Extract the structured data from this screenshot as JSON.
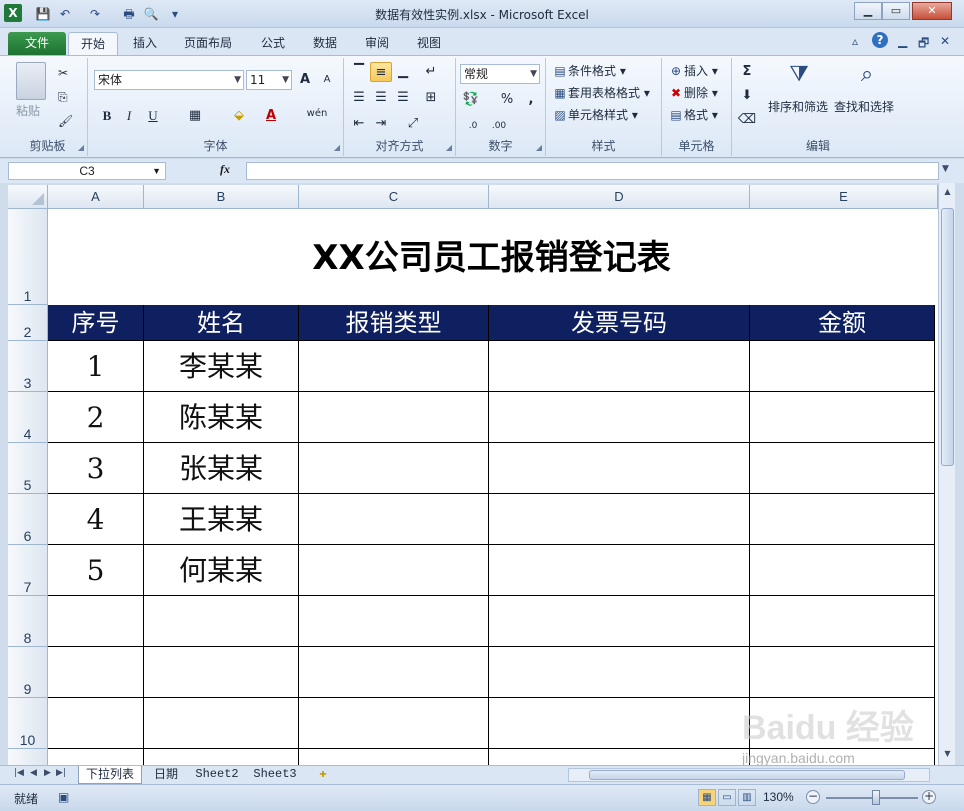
{
  "window": {
    "title": "数据有效性实例.xlsx - Microsoft Excel",
    "app_icon": "X",
    "minimize": "▁",
    "restore": "▭",
    "close": "✕"
  },
  "qat": {
    "save": "💾",
    "undo": "↶",
    "redo": "↷",
    "print": "🖶",
    "preview": "🔍",
    "more": "▾"
  },
  "ribbon_tabs": [
    "文件",
    "开始",
    "插入",
    "页面布局",
    "公式",
    "数据",
    "审阅",
    "视图"
  ],
  "tab_right": {
    "expand": "▵",
    "help": "?",
    "minimize": "▁",
    "restore": "🗗",
    "close": "✕"
  },
  "ribbon": {
    "clipboard": {
      "label": "剪贴板",
      "paste": "粘贴",
      "cut": "✂",
      "copy": "⎘",
      "format_painter": "🖌"
    },
    "font": {
      "label": "字体",
      "font_name": "宋体",
      "font_size": "11",
      "grow": "A",
      "shrink": "A",
      "bold": "B",
      "italic": "I",
      "underline": "U",
      "border": "▦",
      "fill": "⬙",
      "font_color": "A",
      "phonetic": "wén"
    },
    "alignment": {
      "label": "对齐方式"
    },
    "number": {
      "label": "数字",
      "format": "常规",
      "currency": "💱",
      "percent": "%",
      "comma": ",",
      "inc_decimal": ".0",
      "dec_decimal": ".00"
    },
    "styles": {
      "label": "样式",
      "conditional": "条件格式",
      "table": "套用表格格式",
      "cell_styles": "单元格样式"
    },
    "cells": {
      "label": "单元格",
      "insert": "插入",
      "delete": "删除",
      "format": "格式"
    },
    "editing": {
      "label": "编辑",
      "sigma": "Σ",
      "fill": "⬇",
      "clear": "⌫",
      "sort": "排序和筛选",
      "find": "查找和选择"
    }
  },
  "formula_bar": {
    "name_box": "C3",
    "fx": "fx",
    "value": ""
  },
  "columns": [
    "A",
    "B",
    "C",
    "D",
    "E"
  ],
  "rows": [
    "1",
    "2",
    "3",
    "4",
    "5",
    "6",
    "7",
    "8",
    "9",
    "10"
  ],
  "sheet": {
    "title": "XX公司员工报销登记表",
    "headers": [
      "序号",
      "姓名",
      "报销类型",
      "发票号码",
      "金额"
    ],
    "data": [
      [
        "1",
        "李某某",
        "",
        "",
        ""
      ],
      [
        "2",
        "陈某某",
        "",
        "",
        ""
      ],
      [
        "3",
        "张某某",
        "",
        "",
        ""
      ],
      [
        "4",
        "王某某",
        "",
        "",
        ""
      ],
      [
        "5",
        "何某某",
        "",
        "",
        ""
      ]
    ]
  },
  "sheet_tabs": [
    "下拉列表",
    "日期",
    "Sheet2",
    "Sheet3"
  ],
  "status": {
    "ready": "就绪",
    "zoom": "130%",
    "zoom_out": "−",
    "zoom_in": "+"
  },
  "watermark": "Baidu 经验",
  "watermark_url": "jingyan.baidu.com",
  "colors": {
    "header_bg": "#0f2060",
    "file_tab": "#1d7330"
  }
}
